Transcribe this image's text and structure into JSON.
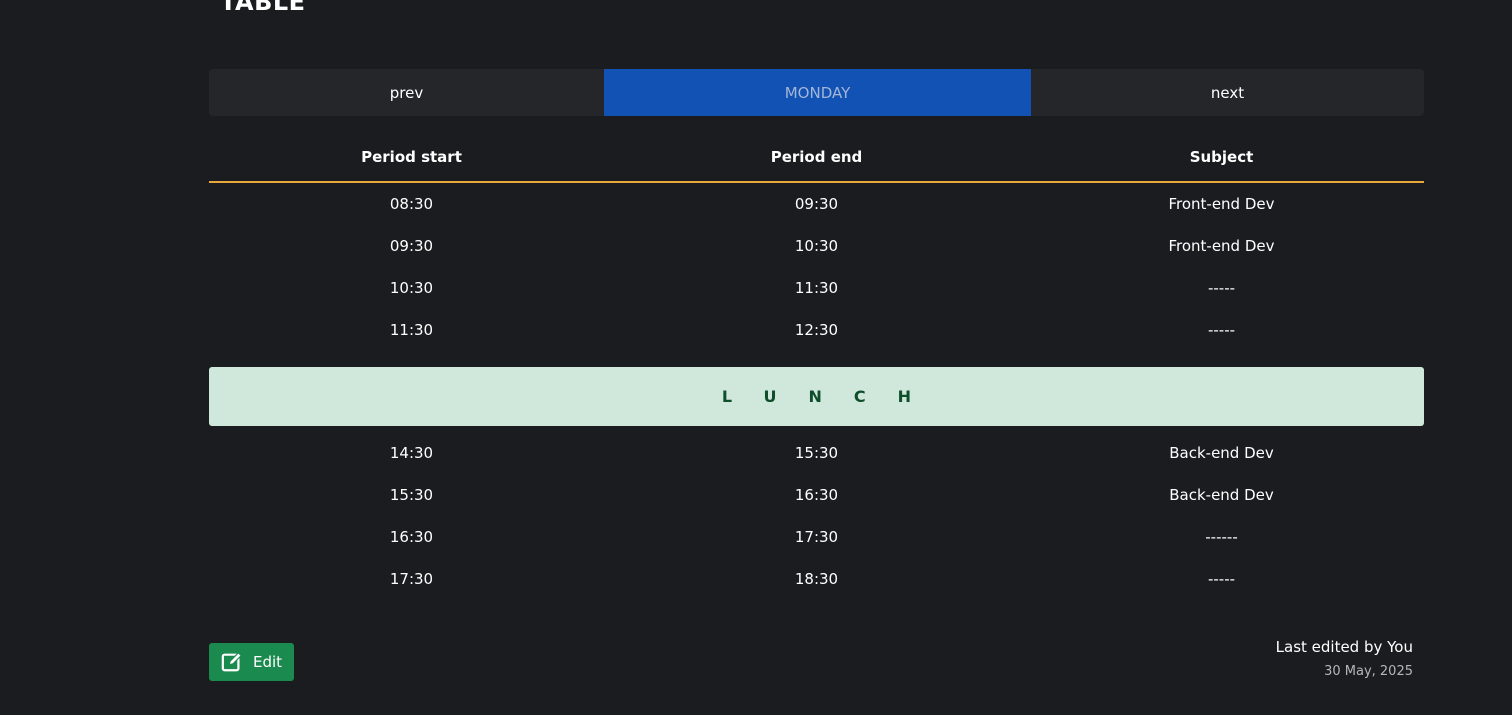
{
  "page": {
    "title": "TABLE"
  },
  "day_nav": {
    "prev_label": "prev",
    "day_label": "MONDAY",
    "next_label": "next"
  },
  "table": {
    "headers": [
      "Period start",
      "Period end",
      "Subject"
    ],
    "rows_before_lunch": [
      [
        "08:30",
        "09:30",
        "Front-end Dev"
      ],
      [
        "09:30",
        "10:30",
        "Front-end Dev"
      ],
      [
        "10:30",
        "11:30",
        "-----"
      ],
      [
        "11:30",
        "12:30",
        "-----"
      ]
    ],
    "lunch_label": "LUNCH",
    "rows_after_lunch": [
      [
        "14:30",
        "15:30",
        "Back-end Dev"
      ],
      [
        "15:30",
        "16:30",
        "Back-end Dev"
      ],
      [
        "16:30",
        "17:30",
        "------"
      ],
      [
        "17:30",
        "18:30",
        "-----"
      ]
    ]
  },
  "footer": {
    "edit_label": "Edit",
    "edit_icon": "edit-icon",
    "last_edited": "Last edited by You",
    "date": "30 May, 2025"
  },
  "colors": {
    "background": "#1b1c1f",
    "accent_blue": "#1152b4",
    "header_underline": "#e8a73a",
    "lunch_bg": "#d0e7dc",
    "lunch_text": "#0e4e2b",
    "edit_green": "#1b8a4f"
  }
}
